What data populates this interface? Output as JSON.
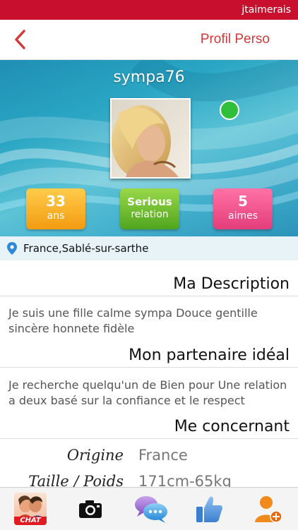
{
  "status_bar": {
    "app_name": "jtaimerais"
  },
  "nav": {
    "title": "Profil Perso",
    "back_icon": "chevron-left-icon",
    "accent": "#d03a3a"
  },
  "profile": {
    "username": "sympa76",
    "online": true,
    "stats": [
      {
        "value": "33",
        "label": "ans",
        "color": "#f5a623"
      },
      {
        "value": "Serious",
        "label": "relation",
        "color": "#6cbf2e"
      },
      {
        "value": "5",
        "label": "aimes",
        "color": "#ef4f8b"
      }
    ],
    "location": "France,Sablé-sur-sarthe"
  },
  "sections": {
    "description": {
      "title": "Ma Description",
      "text": "Je suis une fille calme sympa Douce gentille sincère honnete fidèle"
    },
    "ideal_partner": {
      "title": "Mon partenaire idéal",
      "text": "Je recherche quelqu'un de Bien pour Une relation a deux basé sur la confiance et le respect"
    },
    "about_me": {
      "title": "Me concernant",
      "rows": [
        {
          "label": "Origine",
          "value": "France"
        },
        {
          "label": "Taille / Poids",
          "value": "171cm-65kg"
        }
      ]
    }
  },
  "tab_bar": {
    "chat_label": "CHAT",
    "tabs": [
      "chat-icon",
      "camera-icon",
      "messages-icon",
      "like-icon",
      "add-user-icon"
    ]
  }
}
